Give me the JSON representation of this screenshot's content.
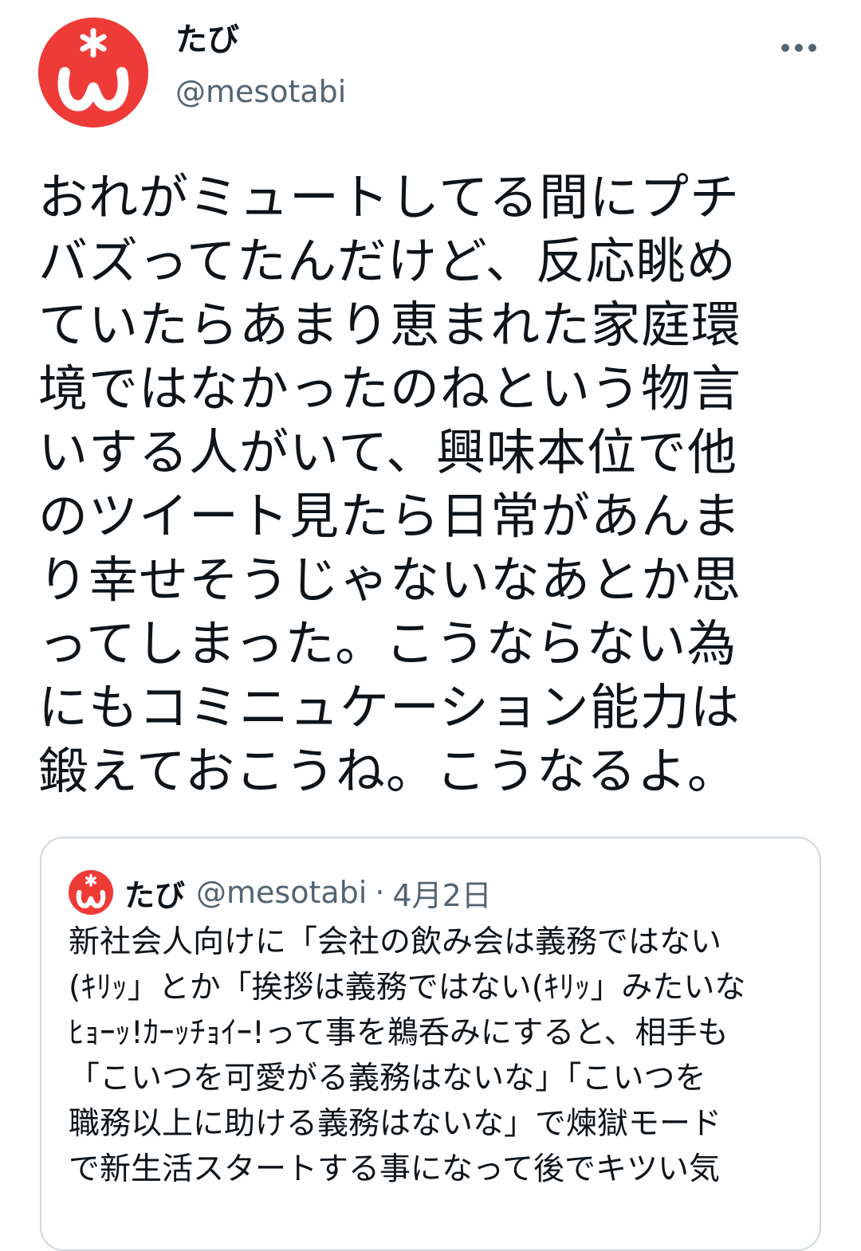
{
  "author": {
    "display_name": "たび",
    "handle": "@mesotabi",
    "avatar_icon": "omega-asterisk-logo",
    "avatar_color": "#ee3b37"
  },
  "menu_icon": "more-horizontal-icon",
  "tweet": {
    "text": "おれがミュートしてる間にプチ\nバズってたんだけど、反応眺め\nていたらあまり恵まれた家庭環\n境ではなかったのねという物言\nいする人がいて、興味本位で他\nのツイート見たら日常があんま\nり幸せそうじゃないなあとか思\nってしまった。こうならない為\nにもコミニュケーション能力は\n鍛えておこうね。こうなるよ。"
  },
  "quoted_tweet": {
    "display_name": "たび",
    "handle": "@mesotabi",
    "separator": "·",
    "date": "4月2日",
    "text": "新社会人向けに「会社の飲み会は義務ではない\n(ｷﾘｯ」とか「挨拶は義務ではない(ｷﾘｯ」みたいな\nﾋｮｰｯ!ｶｰｯﾁｮｲｰ!って事を鵜呑みにすると、相手も\n「こいつを可愛がる義務はないな」「こいつを\n職務以上に助ける義務はないな」で煉獄モード\nで新生活スタートする事になって後でキツい気"
  }
}
